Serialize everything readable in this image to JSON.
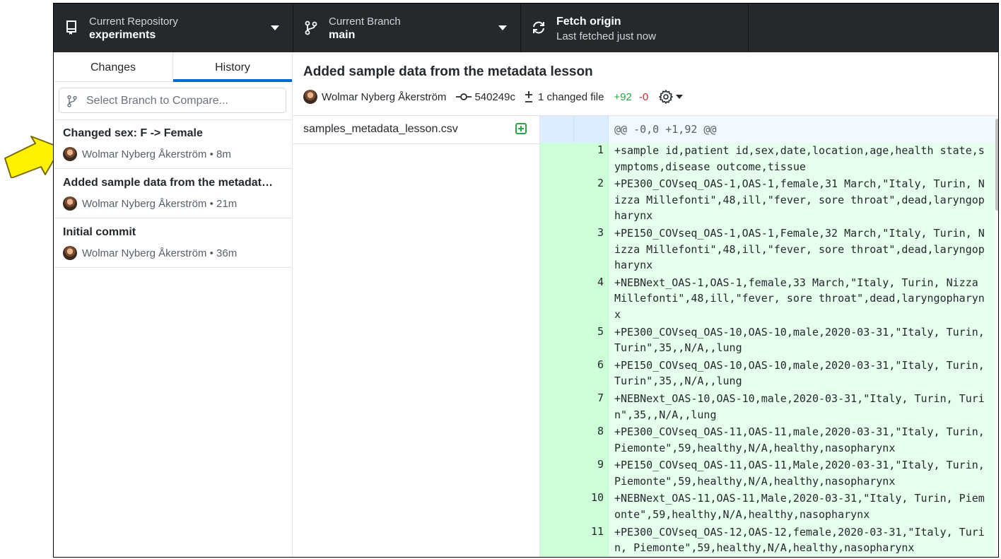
{
  "toolbar": {
    "repo_label": "Current Repository",
    "repo_value": "experiments",
    "branch_label": "Current Branch",
    "branch_value": "main",
    "fetch_label": "Fetch origin",
    "fetch_sub": "Last fetched just now",
    "icons": [
      "repo-icon",
      "branch-icon",
      "sync-icon"
    ]
  },
  "sidebar": {
    "tabs": [
      {
        "label": "Changes"
      },
      {
        "label": "History",
        "active": true
      }
    ],
    "compare_placeholder": "Select Branch to Compare...",
    "commits": [
      {
        "title": "Changed sex: F -> Female",
        "author": "Wolmar Nyberg Åkerström",
        "time": "8m"
      },
      {
        "title": "Added sample data from the metadata lesson",
        "author": "Wolmar Nyberg Åkerström",
        "time": "21m"
      },
      {
        "title": "Initial commit",
        "author": "Wolmar Nyberg Åkerström",
        "time": "36m"
      }
    ]
  },
  "commit_detail": {
    "title": "Added sample data from the metadata lesson",
    "author": "Wolmar Nyberg Åkerström",
    "sha": "540249c",
    "changed_files": "1 changed file",
    "additions": "+92",
    "deletions": "-0"
  },
  "files": [
    {
      "name": "samples_metadata_lesson.csv",
      "status": "added"
    }
  ],
  "diff": {
    "hunk_header": "@@ -0,0 +1,92 @@",
    "lines": [
      {
        "num": "1",
        "text": "+sample id,patient id,sex,date,location,age,health state,symptoms,disease outcome,tissue"
      },
      {
        "num": "2",
        "text": "+PE300_COVseq_OAS-1,OAS-1,female,31 March,\"Italy, Turin, Nizza Millefonti\",48,ill,\"fever, sore throat\",dead,laryngopharynx"
      },
      {
        "num": "3",
        "text": "+PE150_COVseq_OAS-1,OAS-1,Female,32 March,\"Italy, Turin, Nizza Millefonti\",48,ill,\"fever, sore throat\",dead,laryngopharynx"
      },
      {
        "num": "4",
        "text": "+NEBNext_OAS-1,OAS-1,female,33 March,\"Italy, Turin, Nizza Millefonti\",48,ill,\"fever, sore throat\",dead,laryngopharynx"
      },
      {
        "num": "5",
        "text": "+PE300_COVseq_OAS-10,OAS-10,male,2020-03-31,\"Italy, Turin, Turin\",35,,N/A,,lung"
      },
      {
        "num": "6",
        "text": "+PE150_COVseq_OAS-10,OAS-10,male,2020-03-31,\"Italy, Turin, Turin\",35,,N/A,,lung"
      },
      {
        "num": "7",
        "text": "+NEBNext_OAS-10,OAS-10,male,2020-03-31,\"Italy, Turin, Turin\",35,,N/A,,lung"
      },
      {
        "num": "8",
        "text": "+PE300_COVseq_OAS-11,OAS-11,male,2020-03-31,\"Italy, Turin, Piemonte\",59,healthy,N/A,healthy,nasopharynx"
      },
      {
        "num": "9",
        "text": "+PE150_COVseq_OAS-11,OAS-11,Male,2020-03-31,\"Italy, Turin, Piemonte\",59,healthy,N/A,healthy,nasopharynx"
      },
      {
        "num": "10",
        "text": "+NEBNext_OAS-11,OAS-11,Male,2020-03-31,\"Italy, Turin, Piemonte\",59,healthy,N/A,healthy,nasopharynx"
      },
      {
        "num": "11",
        "text": "+PE300_COVseq_OAS-12,OAS-12,female,2020-03-31,\"Italy, Turin, Piemonte\",59,healthy,N/A,healthy,nasopharynx"
      }
    ]
  },
  "colors": {
    "toolbar_bg": "#24292e",
    "tab_accent": "#0366d6",
    "addition_green": "#28a745",
    "deletion_red": "#cb2431",
    "added_line_bg": "#e6ffed",
    "annotation_arrow": "#fff200"
  }
}
